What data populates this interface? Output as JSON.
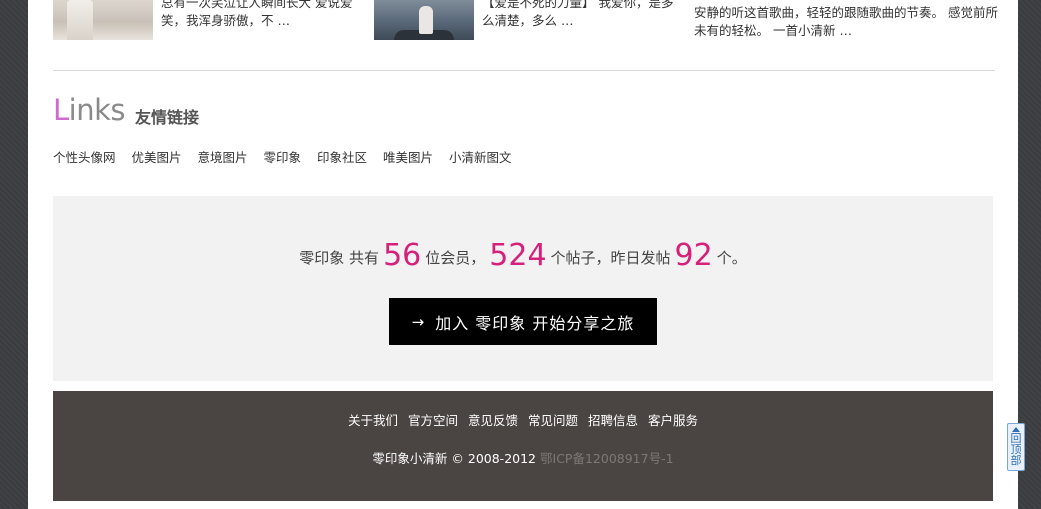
{
  "articles": [
    {
      "line1": "总有一次笑泣让人瞬间长大 爱说爱",
      "line2": "笑，我浑身骄傲，不 …"
    },
    {
      "line1": "【爱是不死的力量】 我爱你，是多",
      "line2": "么清楚，多么 …"
    },
    {
      "line1": "安静的听这首歌曲，轻轻的跟随歌曲的节奏。 感觉前所",
      "line2": "未有的轻松。 一首小清新 …"
    }
  ],
  "links": {
    "heading_first_letter": "L",
    "heading_rest": "inks",
    "heading_cn": "友情链接",
    "items": [
      "个性头像网",
      "优美图片",
      "意境图片",
      "零印象",
      "印象社区",
      "唯美图片",
      "小清新图文"
    ]
  },
  "stats": {
    "site_name": "零印象",
    "text_total": "共有",
    "members": "56",
    "text_members": "位会员，",
    "posts": "524",
    "text_posts": "个帖子，昨日发帖",
    "yesterday": "92",
    "text_end": "个。"
  },
  "join_button": {
    "arrow": "→",
    "label": "加入 零印象 开始分享之旅"
  },
  "footer": {
    "links": [
      "关于我们",
      "官方空间",
      "意见反馈",
      "常见问题",
      "招聘信息",
      "客户服务"
    ],
    "copyright": "零印象小清新 © 2008-2012",
    "icp": "鄂ICP备12008917号-1"
  },
  "back_to_top": {
    "label": "回顶部",
    "icon": "up-triangle-icon"
  },
  "colors": {
    "accent_number": "#d6217a",
    "links_accent": "#cf6acf",
    "footer_bg": "#4a4443",
    "stats_bg": "#f2f2f2"
  }
}
